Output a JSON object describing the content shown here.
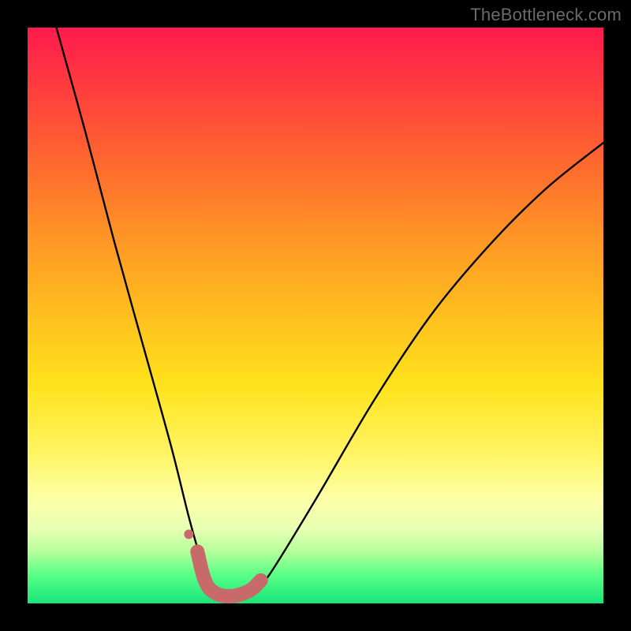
{
  "watermark": "TheBottleneck.com",
  "chart_data": {
    "type": "line",
    "title": "",
    "xlabel": "",
    "ylabel": "",
    "xlim": [
      0,
      100
    ],
    "ylim": [
      0,
      100
    ],
    "series": [
      {
        "name": "curve",
        "x": [
          5,
          10,
          15,
          20,
          25,
          28,
          30,
          31.5,
          33,
          35,
          37,
          39,
          42,
          50,
          60,
          70,
          80,
          90,
          100
        ],
        "y": [
          100,
          82,
          63,
          45,
          27,
          15,
          8,
          4,
          2,
          1,
          1.2,
          2,
          5,
          18,
          35,
          50,
          62,
          72,
          80
        ]
      }
    ],
    "highlight": {
      "name": "bottom-marker",
      "color": "#c96a6a",
      "x": [
        29.5,
        30.5,
        31.5,
        33,
        34.5,
        36,
        37.5,
        39,
        40.5
      ],
      "y": [
        9,
        4.5,
        2.5,
        1.5,
        1.2,
        1.3,
        1.7,
        2.4,
        4
      ]
    },
    "extra_point": {
      "x": 28,
      "y": 12,
      "r": 6,
      "color": "#c96a6a"
    }
  }
}
